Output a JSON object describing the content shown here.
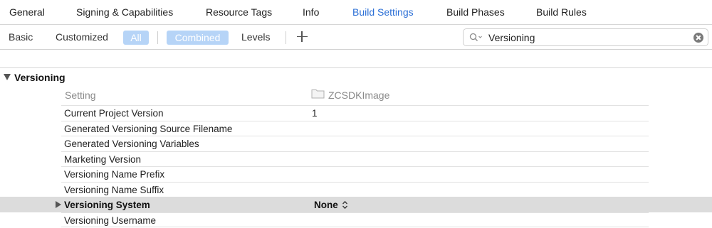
{
  "tabs": [
    {
      "label": "General",
      "active": false
    },
    {
      "label": "Signing & Capabilities",
      "active": false
    },
    {
      "label": "Resource Tags",
      "active": false
    },
    {
      "label": "Info",
      "active": false
    },
    {
      "label": "Build Settings",
      "active": true
    },
    {
      "label": "Build Phases",
      "active": false
    },
    {
      "label": "Build Rules",
      "active": false
    }
  ],
  "filter": {
    "basic": "Basic",
    "customized": "Customized",
    "all": "All",
    "combined": "Combined",
    "levels": "Levels",
    "add_icon": "plus-icon"
  },
  "search": {
    "value": "Versioning",
    "icon": "search-icon",
    "clear_icon": "clear-icon"
  },
  "section": {
    "title": "Versioning",
    "expanded": true
  },
  "columns": {
    "setting": "Setting",
    "target": "ZCSDKImage",
    "target_icon": "folder-icon"
  },
  "rows": [
    {
      "label": "Current Project Version",
      "value": "1"
    },
    {
      "label": "Generated Versioning Source Filename",
      "value": ""
    },
    {
      "label": "Generated Versioning Variables",
      "value": ""
    },
    {
      "label": "Marketing Version",
      "value": ""
    },
    {
      "label": "Versioning Name Prefix",
      "value": ""
    },
    {
      "label": "Versioning Name Suffix",
      "value": ""
    },
    {
      "label": "Versioning System",
      "value": "None",
      "selected": true,
      "expandable": true
    },
    {
      "label": "Versioning Username",
      "value": ""
    }
  ],
  "colors": {
    "accent": "#2b6fd6",
    "pill_bg": "#b6d4f7",
    "selected_row": "#dcdcdc"
  }
}
